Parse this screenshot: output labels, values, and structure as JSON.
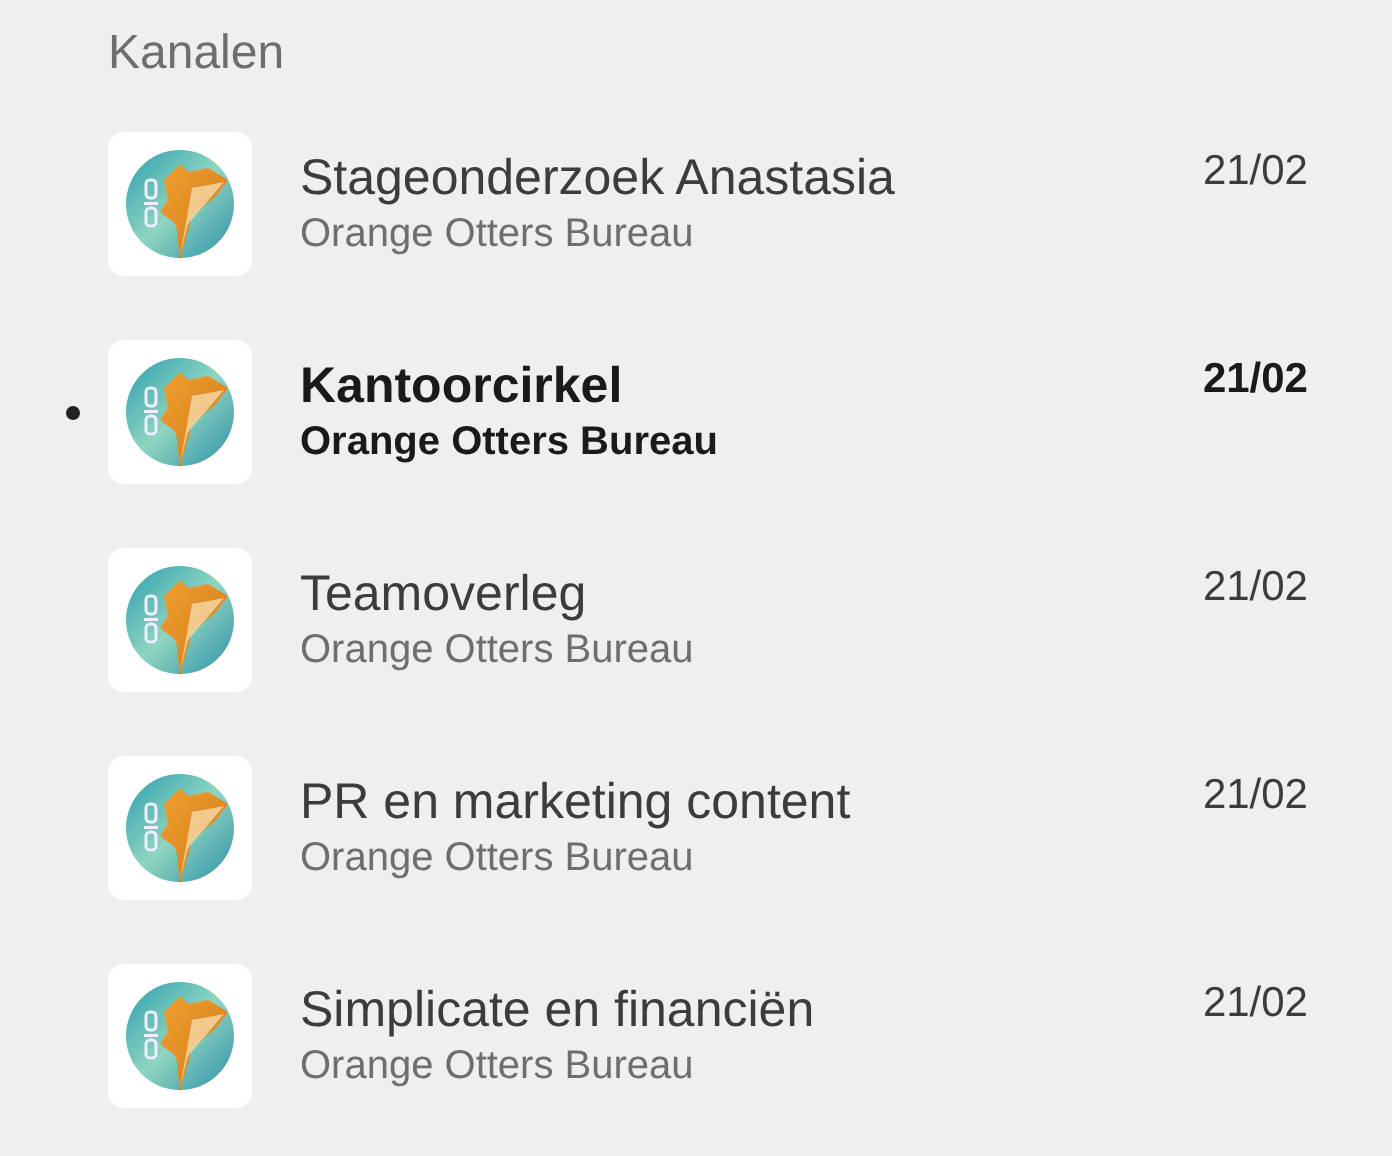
{
  "section_title": "Kanalen",
  "channels": [
    {
      "name": "Stageonderzoek Anastasia",
      "workspace": "Orange Otters Bureau",
      "date": "21/02",
      "unread": false
    },
    {
      "name": "Kantoorcirkel",
      "workspace": "Orange Otters Bureau",
      "date": "21/02",
      "unread": true
    },
    {
      "name": "Teamoverleg",
      "workspace": "Orange Otters Bureau",
      "date": "21/02",
      "unread": false
    },
    {
      "name": "PR en marketing content",
      "workspace": "Orange Otters Bureau",
      "date": "21/02",
      "unread": false
    },
    {
      "name": "Simplicate en financiën",
      "workspace": "Orange Otters Bureau",
      "date": "21/02",
      "unread": false
    }
  ]
}
